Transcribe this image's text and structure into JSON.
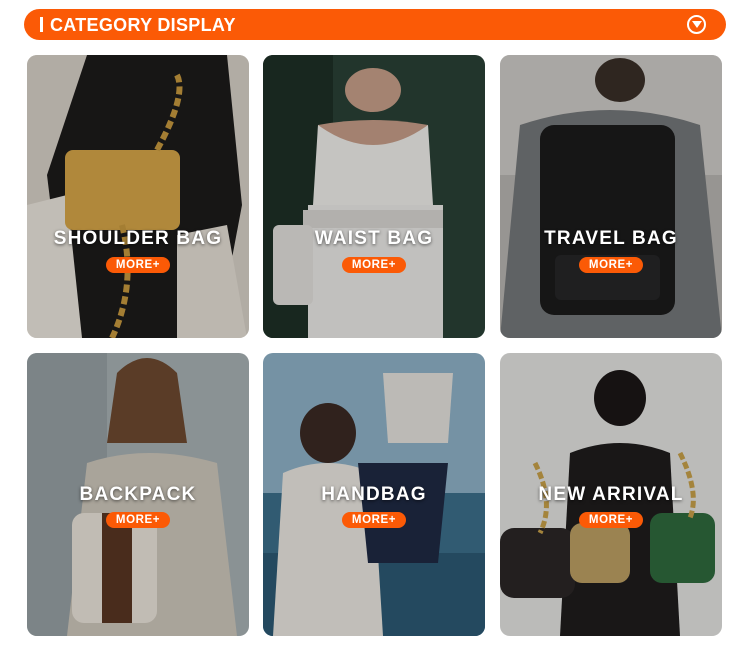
{
  "header": {
    "title": "CATEGORY DISPLAY",
    "toggle_icon": "chevron-down-circle-icon"
  },
  "accent_color": "#fb5a06",
  "categories": [
    {
      "label": "SHOULDER BAG",
      "more": "MORE+"
    },
    {
      "label": "WAIST BAG",
      "more": "MORE+"
    },
    {
      "label": "TRAVEL BAG",
      "more": "MORE+"
    },
    {
      "label": "BACKPACK",
      "more": "MORE+"
    },
    {
      "label": "HANDBAG",
      "more": "MORE+"
    },
    {
      "label": "NEW ARRIVAL",
      "more": "MORE+"
    }
  ]
}
